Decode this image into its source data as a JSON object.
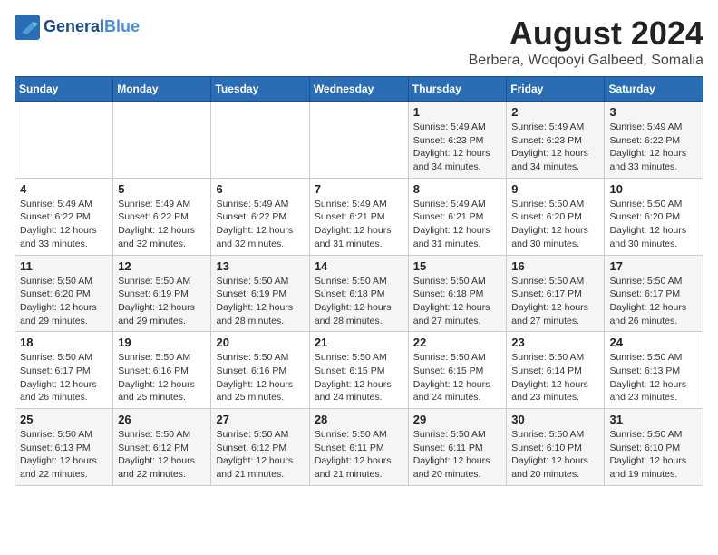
{
  "header": {
    "logo_line1": "General",
    "logo_line2": "Blue",
    "title": "August 2024",
    "subtitle": "Berbera, Woqooyi Galbeed, Somalia"
  },
  "weekdays": [
    "Sunday",
    "Monday",
    "Tuesday",
    "Wednesday",
    "Thursday",
    "Friday",
    "Saturday"
  ],
  "weeks": [
    [
      {
        "day": "",
        "info": ""
      },
      {
        "day": "",
        "info": ""
      },
      {
        "day": "",
        "info": ""
      },
      {
        "day": "",
        "info": ""
      },
      {
        "day": "1",
        "info": "Sunrise: 5:49 AM\nSunset: 6:23 PM\nDaylight: 12 hours\nand 34 minutes."
      },
      {
        "day": "2",
        "info": "Sunrise: 5:49 AM\nSunset: 6:23 PM\nDaylight: 12 hours\nand 34 minutes."
      },
      {
        "day": "3",
        "info": "Sunrise: 5:49 AM\nSunset: 6:22 PM\nDaylight: 12 hours\nand 33 minutes."
      }
    ],
    [
      {
        "day": "4",
        "info": "Sunrise: 5:49 AM\nSunset: 6:22 PM\nDaylight: 12 hours\nand 33 minutes."
      },
      {
        "day": "5",
        "info": "Sunrise: 5:49 AM\nSunset: 6:22 PM\nDaylight: 12 hours\nand 32 minutes."
      },
      {
        "day": "6",
        "info": "Sunrise: 5:49 AM\nSunset: 6:22 PM\nDaylight: 12 hours\nand 32 minutes."
      },
      {
        "day": "7",
        "info": "Sunrise: 5:49 AM\nSunset: 6:21 PM\nDaylight: 12 hours\nand 31 minutes."
      },
      {
        "day": "8",
        "info": "Sunrise: 5:49 AM\nSunset: 6:21 PM\nDaylight: 12 hours\nand 31 minutes."
      },
      {
        "day": "9",
        "info": "Sunrise: 5:50 AM\nSunset: 6:20 PM\nDaylight: 12 hours\nand 30 minutes."
      },
      {
        "day": "10",
        "info": "Sunrise: 5:50 AM\nSunset: 6:20 PM\nDaylight: 12 hours\nand 30 minutes."
      }
    ],
    [
      {
        "day": "11",
        "info": "Sunrise: 5:50 AM\nSunset: 6:20 PM\nDaylight: 12 hours\nand 29 minutes."
      },
      {
        "day": "12",
        "info": "Sunrise: 5:50 AM\nSunset: 6:19 PM\nDaylight: 12 hours\nand 29 minutes."
      },
      {
        "day": "13",
        "info": "Sunrise: 5:50 AM\nSunset: 6:19 PM\nDaylight: 12 hours\nand 28 minutes."
      },
      {
        "day": "14",
        "info": "Sunrise: 5:50 AM\nSunset: 6:18 PM\nDaylight: 12 hours\nand 28 minutes."
      },
      {
        "day": "15",
        "info": "Sunrise: 5:50 AM\nSunset: 6:18 PM\nDaylight: 12 hours\nand 27 minutes."
      },
      {
        "day": "16",
        "info": "Sunrise: 5:50 AM\nSunset: 6:17 PM\nDaylight: 12 hours\nand 27 minutes."
      },
      {
        "day": "17",
        "info": "Sunrise: 5:50 AM\nSunset: 6:17 PM\nDaylight: 12 hours\nand 26 minutes."
      }
    ],
    [
      {
        "day": "18",
        "info": "Sunrise: 5:50 AM\nSunset: 6:17 PM\nDaylight: 12 hours\nand 26 minutes."
      },
      {
        "day": "19",
        "info": "Sunrise: 5:50 AM\nSunset: 6:16 PM\nDaylight: 12 hours\nand 25 minutes."
      },
      {
        "day": "20",
        "info": "Sunrise: 5:50 AM\nSunset: 6:16 PM\nDaylight: 12 hours\nand 25 minutes."
      },
      {
        "day": "21",
        "info": "Sunrise: 5:50 AM\nSunset: 6:15 PM\nDaylight: 12 hours\nand 24 minutes."
      },
      {
        "day": "22",
        "info": "Sunrise: 5:50 AM\nSunset: 6:15 PM\nDaylight: 12 hours\nand 24 minutes."
      },
      {
        "day": "23",
        "info": "Sunrise: 5:50 AM\nSunset: 6:14 PM\nDaylight: 12 hours\nand 23 minutes."
      },
      {
        "day": "24",
        "info": "Sunrise: 5:50 AM\nSunset: 6:13 PM\nDaylight: 12 hours\nand 23 minutes."
      }
    ],
    [
      {
        "day": "25",
        "info": "Sunrise: 5:50 AM\nSunset: 6:13 PM\nDaylight: 12 hours\nand 22 minutes."
      },
      {
        "day": "26",
        "info": "Sunrise: 5:50 AM\nSunset: 6:12 PM\nDaylight: 12 hours\nand 22 minutes."
      },
      {
        "day": "27",
        "info": "Sunrise: 5:50 AM\nSunset: 6:12 PM\nDaylight: 12 hours\nand 21 minutes."
      },
      {
        "day": "28",
        "info": "Sunrise: 5:50 AM\nSunset: 6:11 PM\nDaylight: 12 hours\nand 21 minutes."
      },
      {
        "day": "29",
        "info": "Sunrise: 5:50 AM\nSunset: 6:11 PM\nDaylight: 12 hours\nand 20 minutes."
      },
      {
        "day": "30",
        "info": "Sunrise: 5:50 AM\nSunset: 6:10 PM\nDaylight: 12 hours\nand 20 minutes."
      },
      {
        "day": "31",
        "info": "Sunrise: 5:50 AM\nSunset: 6:10 PM\nDaylight: 12 hours\nand 19 minutes."
      }
    ]
  ]
}
